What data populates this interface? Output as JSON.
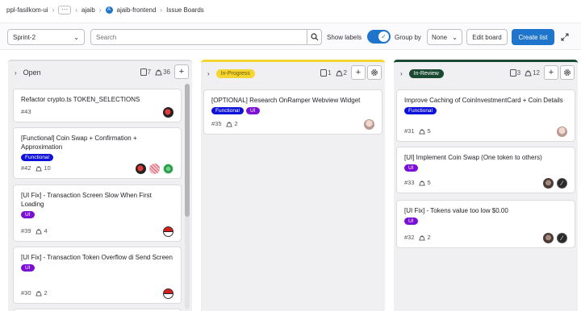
{
  "breadcrumb": {
    "items": [
      "ppl-fasilkom-ui",
      "ajaib",
      "ajaib-frontend",
      "Issue Boards"
    ],
    "ellipsis": "···",
    "project_initial": "A"
  },
  "filter": {
    "iteration": "Sprint-2",
    "search_placeholder": "Search",
    "show_labels": "Show labels",
    "group_by": "Group by",
    "group_value": "None",
    "edit_board": "Edit board",
    "create_list": "Create list"
  },
  "colors": {
    "primary": "#1f75cb",
    "in_progress": "#f5d631",
    "in_review": "#1a4a32",
    "functional": "#0d11d9",
    "ui": "#7c0fd6"
  },
  "lists": {
    "open": {
      "title": "Open",
      "issues": "7",
      "weight": "36",
      "cards": [
        {
          "title": "Refactor crypto.ts TOKEN_SELECTIONS",
          "id": "#43",
          "labels": [],
          "weight": ""
        },
        {
          "title": "[Functional] Coin Swap + Confirmation + Approximation",
          "id": "#42",
          "labels": [
            "Functional"
          ],
          "weight": "10"
        },
        {
          "title": "[UI Fix] - Transaction Screen Slow When First Loading",
          "id": "#39",
          "labels": [
            "UI"
          ],
          "weight": "4"
        },
        {
          "title": "[UI Fix] - Transaction Token Overflow di Send Screen",
          "id": "#30",
          "labels": [
            "UI"
          ],
          "weight": "2"
        }
      ]
    },
    "in_progress": {
      "title": "In-Progress",
      "issues": "1",
      "weight": "2",
      "cards": [
        {
          "title": "[OPTIONAL] Research OnRamper Webview Widget",
          "id": "#35",
          "labels": [
            "Functional",
            "UI"
          ],
          "weight": "2"
        }
      ]
    },
    "in_review": {
      "title": "In-Review",
      "issues": "3",
      "weight": "12",
      "cards": [
        {
          "title": "Improve Caching of CoinInvestmentCard + Coin Details",
          "id": "#31",
          "labels": [
            "Functional"
          ],
          "weight": "5"
        },
        {
          "title": "[UI] Implement Coin Swap (One token to others)",
          "id": "#33",
          "labels": [
            "UI"
          ],
          "weight": "5"
        },
        {
          "title": "[UI Fix] - Tokens value too low $0.00",
          "id": "#32",
          "labels": [
            "UI"
          ],
          "weight": "2"
        }
      ]
    }
  }
}
